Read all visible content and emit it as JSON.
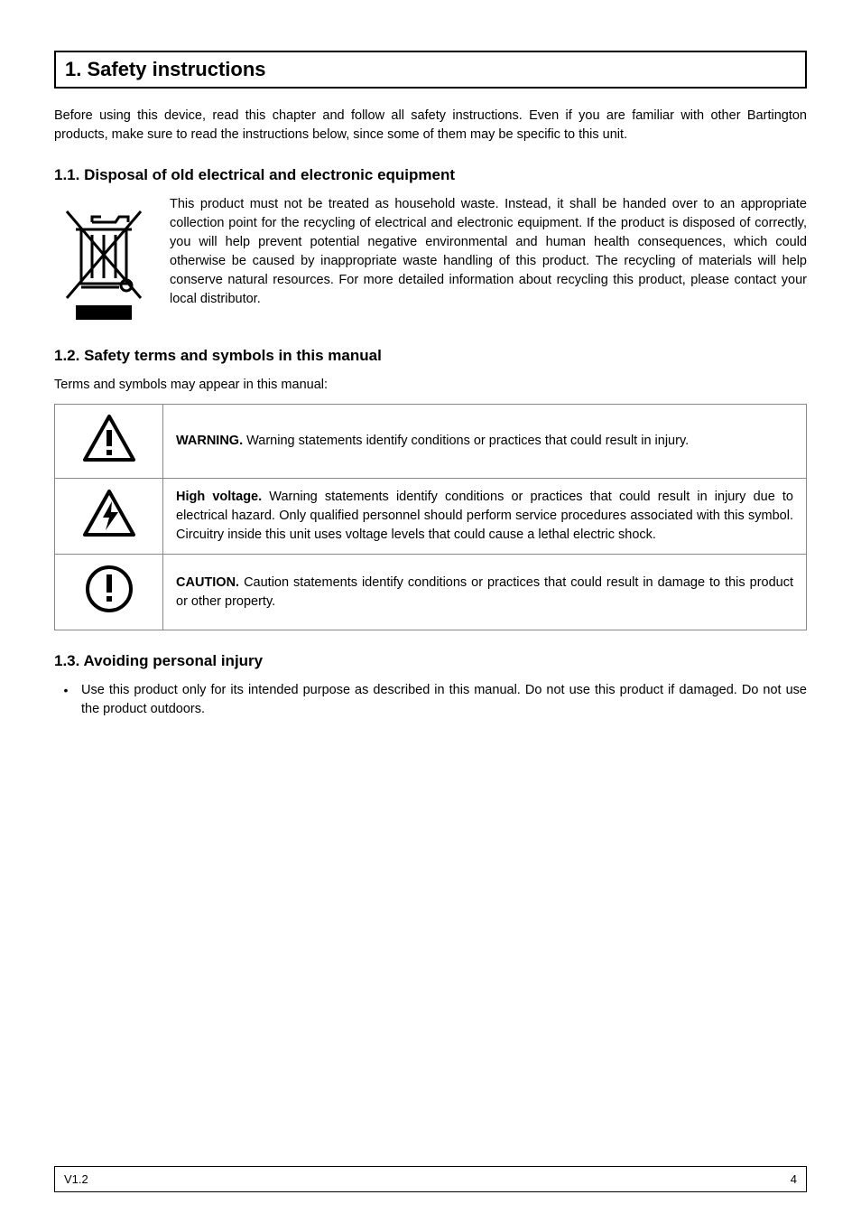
{
  "title": "1. Safety instructions",
  "intro": "Before using this device, read this chapter and follow all safety instructions. Even if you are familiar with other Bartington products, make sure to read the instructions below, since some of them may be specific to this unit.",
  "disposal": {
    "heading": "1.1. Disposal of old electrical and electronic equipment",
    "paragraph": "This product must not be treated as household waste. Instead, it shall be handed over to an appropriate collection point for the recycling of electrical and electronic equipment. If the product is disposed of correctly, you will help prevent potential negative environmental and human health consequences, which could otherwise be caused by inappropriate waste handling of this product. The recycling of materials will help conserve natural resources. For more detailed information about recycling this product, please contact your local distributor.",
    "icon_name": "weee-crossed-bin-icon"
  },
  "safety_terms": {
    "heading": "1.2. Safety terms and symbols in this manual",
    "intro": "Terms and symbols may appear in this manual:",
    "rows": [
      {
        "title": "WARNING.",
        "body": " Warning statements identify conditions or practices that could result in injury.",
        "icon_name": "warning-triangle-icon"
      },
      {
        "title": "High voltage.",
        "body": " Warning statements identify conditions or practices that could result in injury due to electrical hazard. Only qualified personnel should perform service procedures associated with this symbol. Circuitry inside this unit uses voltage levels that could cause a lethal electric shock.",
        "icon_name": "high-voltage-triangle-icon"
      },
      {
        "title": "CAUTION.",
        "body": " Caution statements identify conditions or practices that could result in damage to this product or other property.",
        "icon_name": "caution-circle-icon"
      }
    ]
  },
  "avoiding": {
    "heading": "1.3. Avoiding personal injury",
    "bullets": [
      "Use this product only for its intended purpose as described in this manual. Do not use this product if damaged. Do not use the product outdoors."
    ]
  },
  "footer": {
    "left": "V1.2",
    "right": "4"
  }
}
